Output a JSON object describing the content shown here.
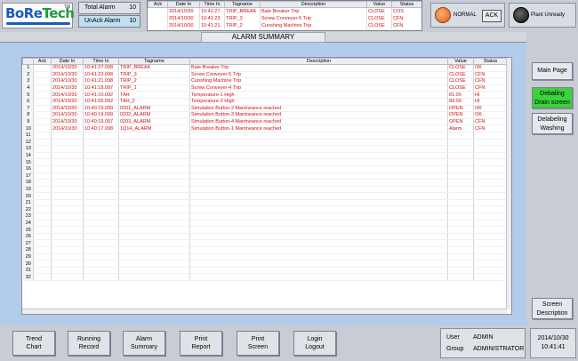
{
  "logo": {
    "text_a": "BoRe",
    "text_b": "Tech",
    "tm": "TM"
  },
  "counters": {
    "total_label": "Total Alarm",
    "total_value": "10",
    "unack_label": "UnAck Alarm",
    "unack_value": "10"
  },
  "mini_table": {
    "headers": [
      "Ack",
      "Date In",
      "Time In",
      "Tagname",
      "Description",
      "Value",
      "Status"
    ],
    "rows": [
      [
        "",
        "2014/10/30",
        "10:41:27.",
        "TRIP_BREAK",
        "Bale Breaker Trip",
        "CLOSE",
        "COS"
      ],
      [
        "",
        "2014/10/30",
        "10:41:23.",
        "TRIP_3",
        "Screw Conveyer-5 Trip",
        "CLOSE",
        "CFN"
      ],
      [
        "",
        "2014/10/30",
        "10:41:21.",
        "TRIP_2",
        "Cunshing Machine Trip",
        "CLOSE",
        "CFN"
      ]
    ]
  },
  "status": {
    "normal_label": "NORMAL",
    "ack_label": "ACK",
    "plant_label": "Plant Unready"
  },
  "page_title": "ALARM SUMMARY",
  "grid": {
    "headers": [
      "",
      "Ack",
      "Date In",
      "Time In",
      "Tagname",
      "Description",
      "Value",
      "Status"
    ],
    "rows": [
      [
        "1",
        "",
        "2014/10/30",
        "10:41:27.098",
        "TRIP_BREAK",
        "Bale Breaker Trip",
        "CLOSE",
        "OK"
      ],
      [
        "2",
        "",
        "2014/10/30",
        "10:41:23.098",
        "TRIP_3",
        "Screw Conveyer-5 Trip",
        "CLOSE",
        "CFN"
      ],
      [
        "3",
        "",
        "2014/10/30",
        "10:41:21.098",
        "TRIP_2",
        "Cunshing Machine Trip",
        "CLOSE",
        "CFN"
      ],
      [
        "4",
        "",
        "2014/10/30",
        "10:41:18.097",
        "TRIP_1",
        "Screw Conveyer-4 Trip",
        "CLOSE",
        "CFN"
      ],
      [
        "5",
        "",
        "2014/10/30",
        "10:41:10.092",
        "TAH",
        "Temperature-1 High",
        "81.00",
        "HI"
      ],
      [
        "6",
        "",
        "2014/10/30",
        "10:41:05.092",
        "TAH_2",
        "Temperature-2 High",
        "89.00",
        "HI"
      ],
      [
        "7",
        "",
        "2014/10/30",
        "10:40:19.099",
        "0201_ALARM",
        "Simulation Button-2 Mantneance reached",
        "OPEN",
        "OK"
      ],
      [
        "8",
        "",
        "2014/10/30",
        "10:40:19.099",
        "0202_ALARM",
        "Simulation Button-3 Mantneance reached",
        "OPEN",
        "OK"
      ],
      [
        "9",
        "",
        "2014/10/30",
        "10:40:19.097",
        "0203_ALARM",
        "Simulation Button-4 Mantneance reached",
        "OPEN",
        "CFN"
      ],
      [
        "10",
        "",
        "2014/10/30",
        "10:40:17.098",
        "1Q14_ALARM",
        "Simulation Button-1 Mantneance reached",
        "Alarm",
        "CFN"
      ]
    ],
    "blank_rows": [
      "11",
      "12",
      "13",
      "14",
      "15",
      "16",
      "17",
      "18",
      "19",
      "20",
      "21",
      "22",
      "23",
      "24",
      "25",
      "26",
      "27",
      "28",
      "29",
      "30",
      "31",
      "32"
    ]
  },
  "side_buttons": {
    "main_page": "Main Page",
    "debaling_drain_1": "Debaling",
    "debaling_drain_2": "Drain screen",
    "debaling_washing_1": "Delabeling",
    "debaling_washing_2": "Washing",
    "screen_desc_1": "Screen",
    "screen_desc_2": "Description"
  },
  "bottom_buttons": {
    "trend_1": "Trend",
    "trend_2": "Chart",
    "running_1": "Running",
    "running_2": "Record",
    "alarm_1": "Alarm",
    "alarm_2": "Summary",
    "print_report_1": "Print",
    "print_report_2": "Report",
    "print_screen_1": "Print",
    "print_screen_2": "Screen",
    "login_1": "Login",
    "login_2": "Logout"
  },
  "user": {
    "user_label": "User",
    "user_value": "ADMIN",
    "group_label": "Group",
    "group_value": "ADMINISTRATOR"
  },
  "clock": {
    "date": "2014/10/30",
    "time": "10:41:41"
  }
}
